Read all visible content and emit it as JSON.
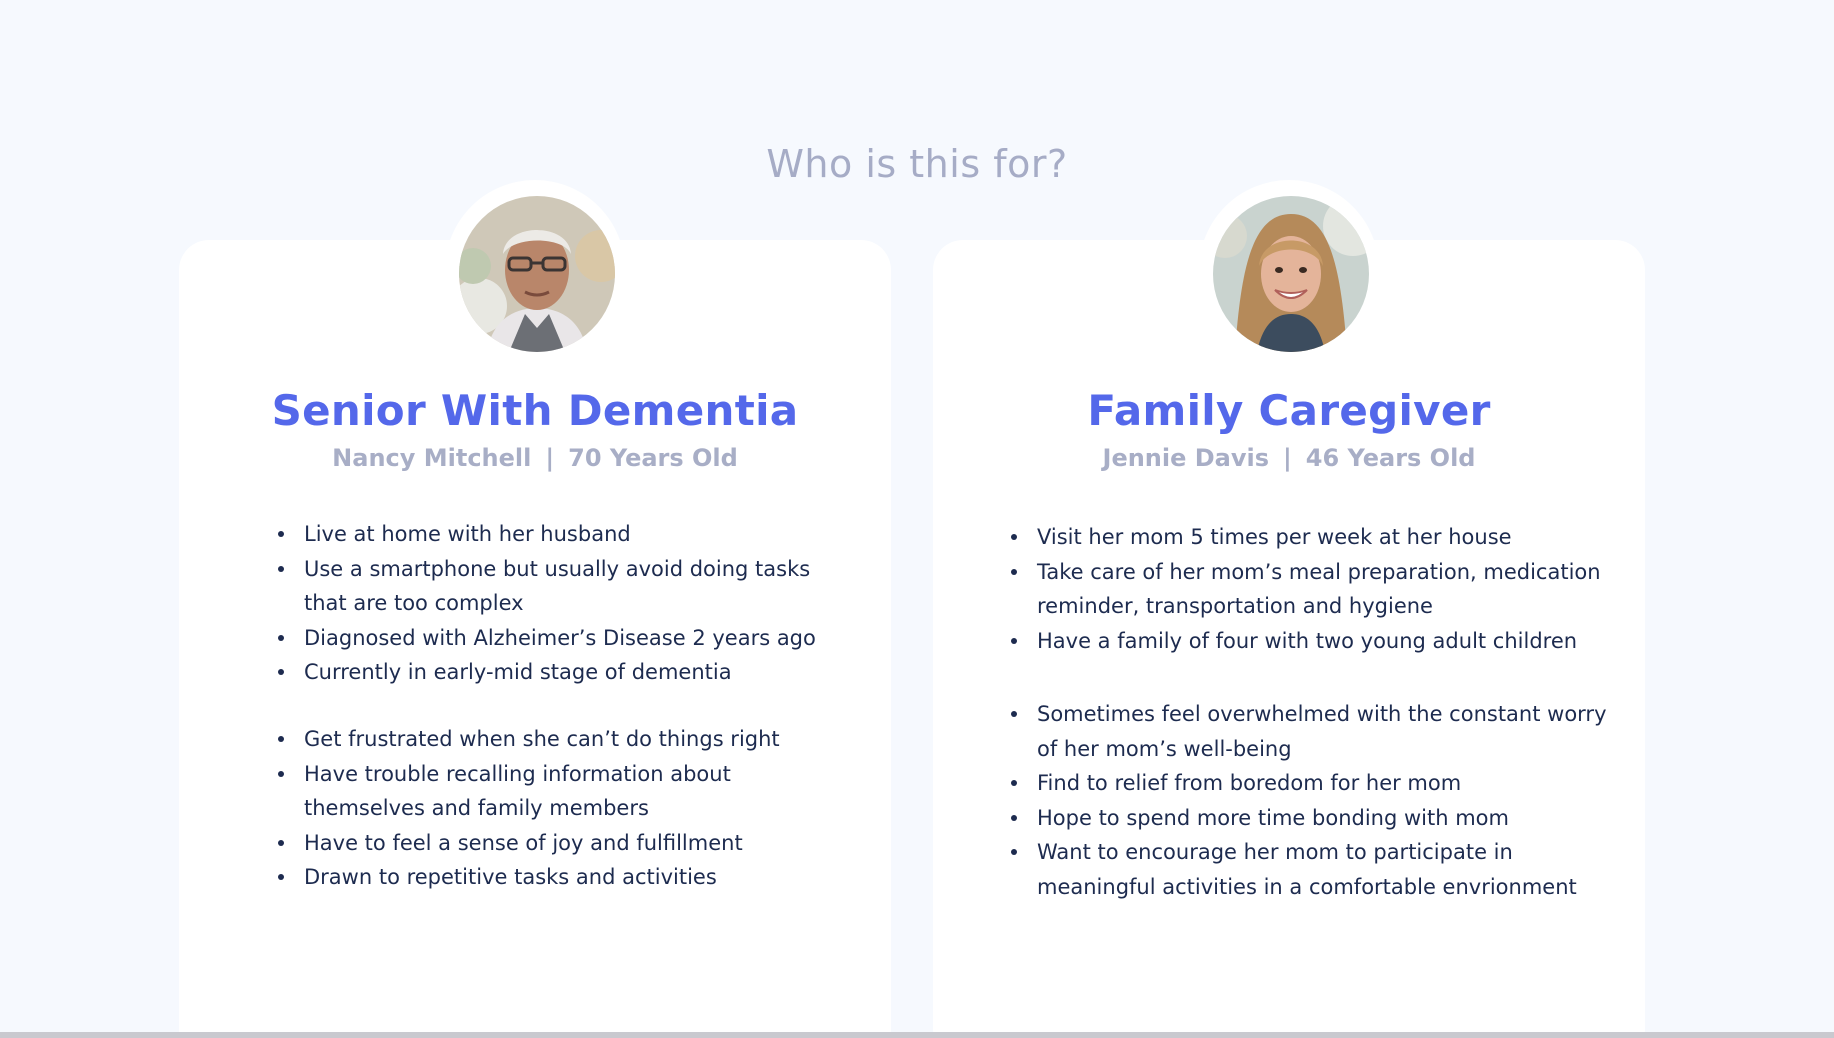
{
  "section": {
    "title": "Who is this for?"
  },
  "personas": [
    {
      "title": "Senior With Dementia",
      "name": "Nancy Mitchell",
      "separator": "|",
      "age": "70 Years Old",
      "group1": [
        "Live at home with her husband",
        "Use a smartphone but usually avoid doing tasks that are too complex",
        "Diagnosed with Alzheimer’s Disease 2 years ago",
        "Currently in early-mid stage of dementia"
      ],
      "group2": [
        "Get frustrated when she can’t do things right",
        "Have trouble recalling information about themselves and family members",
        "Have to feel a sense of joy and fulfillment",
        "Drawn to repetitive tasks and activities"
      ]
    },
    {
      "title": "Family Caregiver",
      "name": "Jennie Davis",
      "separator": "|",
      "age": "46 Years Old",
      "group1": [
        "Visit her mom 5 times per week at her house",
        "Take care of her mom’s meal preparation, medication reminder, transportation and hygiene",
        "Have a family of four with two young adult children"
      ],
      "group2": [
        "Sometimes feel overwhelmed with the constant worry of her mom’s well-being",
        "Find to relief from boredom for her mom",
        "Hope to spend more time bonding with mom",
        "Want to encourage her mom to participate in meaningful activities in a comfortable envrionment"
      ]
    }
  ],
  "colors": {
    "background": "#f6f9fe",
    "accent": "#5468ea",
    "muted": "#a8aec6",
    "text": "#1d2b4f"
  }
}
